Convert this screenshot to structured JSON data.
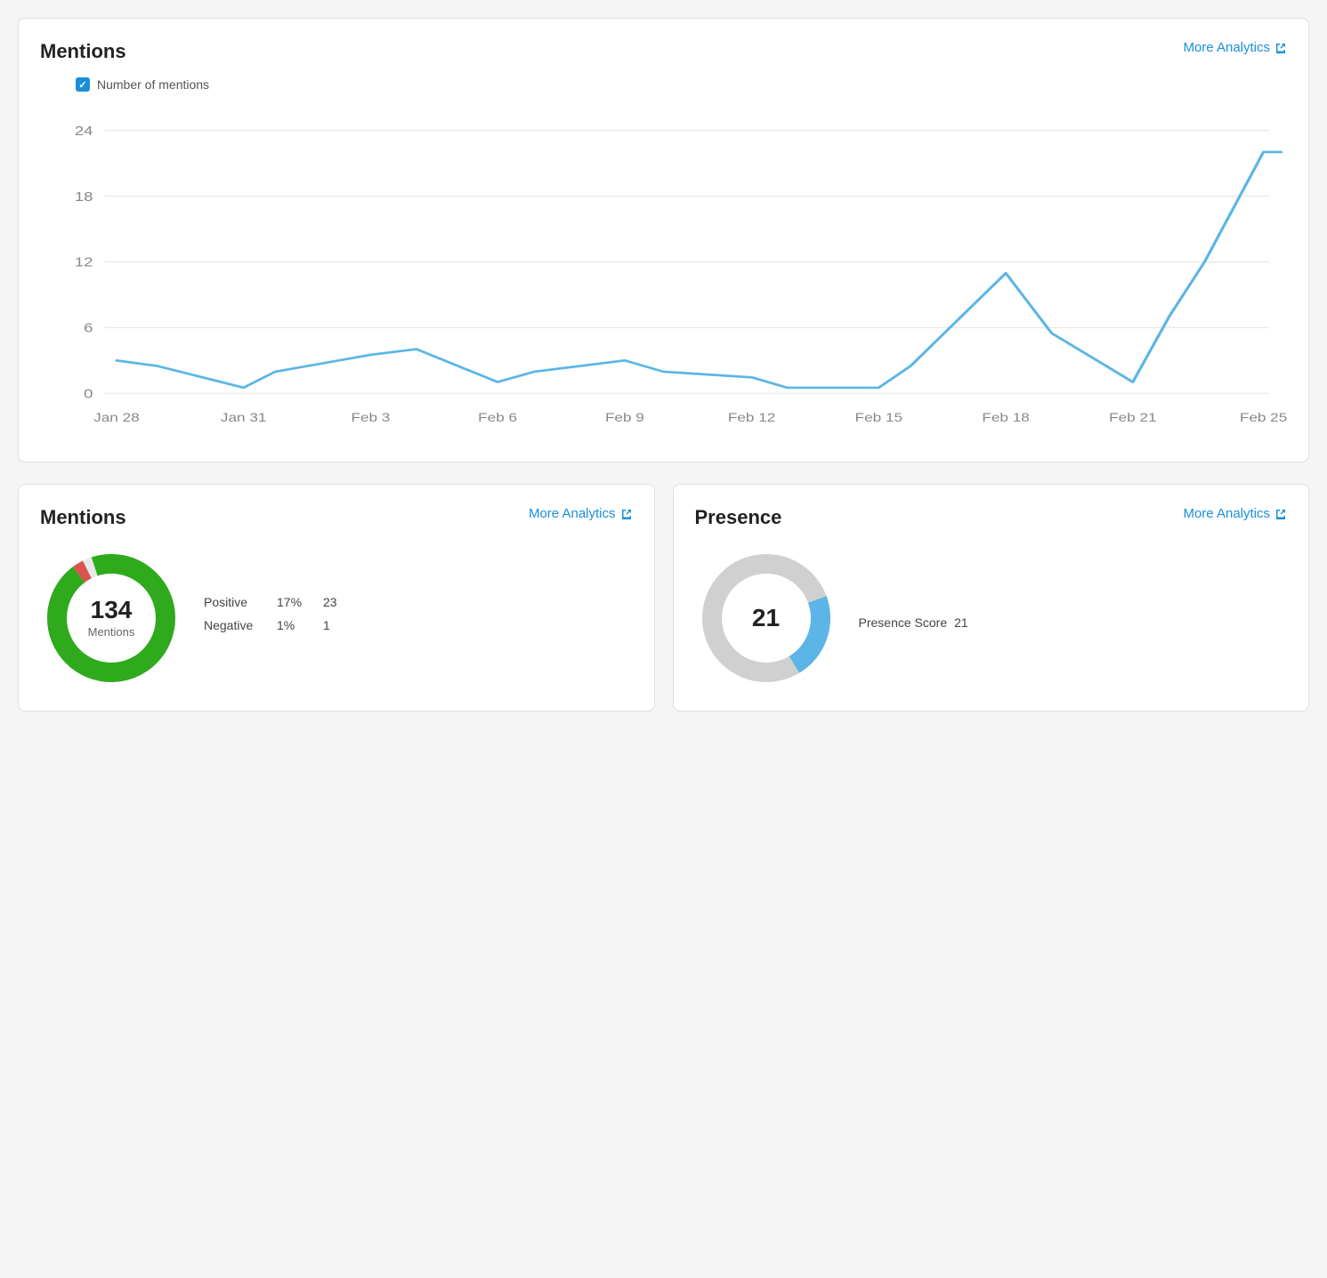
{
  "mentions_chart": {
    "title": "Mentions",
    "more_analytics_label": "More Analytics",
    "legend_label": "Number of mentions",
    "y_axis": [
      0,
      6,
      12,
      18,
      24
    ],
    "x_labels": [
      "Jan 28",
      "Jan 31",
      "Feb 3",
      "Feb 6",
      "Feb 9",
      "Feb 12",
      "Feb 15",
      "Feb 18",
      "Feb 21",
      "Feb 25"
    ],
    "data_points": [
      3,
      2,
      0.5,
      2.5,
      3.5,
      4,
      1.5,
      3,
      3.5,
      2,
      1.5,
      0.5,
      0.5,
      2.5,
      11,
      5.5,
      1,
      7,
      12,
      22,
      22
    ]
  },
  "mentions_donut": {
    "title": "Mentions",
    "more_analytics_label": "More Analytics",
    "total": "134",
    "total_label": "Mentions",
    "positive_label": "Positive",
    "positive_pct": "17%",
    "positive_count": "23",
    "negative_label": "Negative",
    "negative_pct": "1%",
    "negative_count": "1",
    "colors": {
      "green": "#2eaa1c",
      "red": "#d9534f",
      "neutral": "#e0e0e0"
    }
  },
  "presence": {
    "title": "Presence",
    "more_analytics_label": "More Analytics",
    "score_label": "Presence Score",
    "score_value": "21",
    "colors": {
      "blue": "#5bb5e6",
      "gray": "#d0d0d0"
    }
  },
  "icons": {
    "external_link": "↗"
  }
}
